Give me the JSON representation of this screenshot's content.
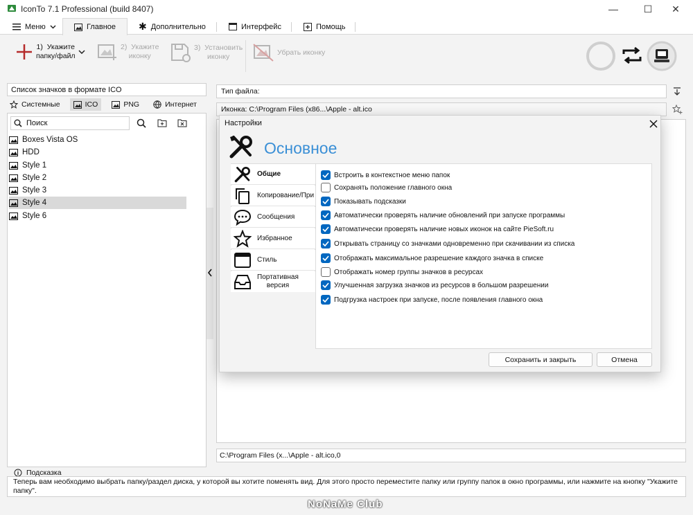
{
  "window": {
    "title": "IconTo 7.1 Professional (build 8407)",
    "minimize": "—",
    "maximize": "☐",
    "close": "✕"
  },
  "tabs": [
    {
      "label": "Меню",
      "icon": "hamburger-icon"
    },
    {
      "label": "Главное",
      "icon": "image-frame-icon"
    },
    {
      "label": "Дополнительно",
      "icon": "asterisk-icon"
    },
    {
      "label": "Интерфейс",
      "icon": "window-icon"
    },
    {
      "label": "Помощь",
      "icon": "plus-square-icon"
    }
  ],
  "ribbon": {
    "step1": "1)  Укажите\nпапку/файл",
    "step2": "2)  Укажите\nиконку",
    "step3": "3)  Установить\nиконку",
    "remove": "Убрать иконку"
  },
  "left": {
    "header": "Список значков в формате ICO",
    "subtabs": [
      {
        "label": "Системные",
        "icon": "star-icon"
      },
      {
        "label": "ICO",
        "icon": "image-icon"
      },
      {
        "label": "PNG",
        "icon": "image-icon"
      },
      {
        "label": "Интернет",
        "icon": "globe-icon"
      }
    ],
    "search_placeholder": "Поиск",
    "items": [
      "Boxes Vista OS",
      "HDD",
      "Style 1",
      "Style 2",
      "Style 3",
      "Style 4",
      "Style 6"
    ]
  },
  "right": {
    "filetype_label": "Тип файла:",
    "icon_path": "Иконка:  C:\\Program Files (x86...\\Apple - alt.ico",
    "bottom_path": "C:\\Program Files (x...\\Apple - alt.ico,0"
  },
  "dialog": {
    "title": "Настройки",
    "heading": "Основное",
    "nav": [
      {
        "label": "Общие"
      },
      {
        "label": "Копирование/При"
      },
      {
        "label": "Сообщения"
      },
      {
        "label": "Избранное"
      },
      {
        "label": "Стиль"
      },
      {
        "label": "Портативная\nверсия"
      }
    ],
    "options": [
      {
        "label": "Встроить в контекстное меню папок",
        "checked": true
      },
      {
        "label": "Сохранять положение главного окна",
        "checked": false
      },
      {
        "label": "Показывать подсказки",
        "checked": true
      },
      {
        "label": "Автоматически проверять наличие обновлений при запуске программы",
        "checked": true
      },
      {
        "label": "Автоматически проверять наличие новых иконок на сайте PieSoft.ru",
        "checked": true
      },
      {
        "label": "Открывать страницу со значками одновременно при скачивании из списка",
        "checked": true
      },
      {
        "label": "Отображать максимальное разрешение каждого значка в списке",
        "checked": true
      },
      {
        "label": "Отображать номер группы значков в ресурсах",
        "checked": false
      },
      {
        "label": "Улучшенная загрузка значков из ресурсов в большом разрешении",
        "checked": true
      },
      {
        "label": "Подгрузка настроек при запуске, после появления главного окна",
        "checked": true
      }
    ],
    "save_label": "Сохранить и закрыть",
    "cancel_label": "Отмена"
  },
  "hint": {
    "title": "Подсказка",
    "text": "Теперь вам необходимо выбрать папку/раздел диска, у которой вы хотите поменять вид. Для этого просто переместите папку или группу папок в окно программы, или нажмите на кнопку \"Укажите папку\"."
  },
  "watermark": "NoNaMe Club",
  "colors": {
    "accent": "#0067c0",
    "heading": "#3a8fd6"
  }
}
